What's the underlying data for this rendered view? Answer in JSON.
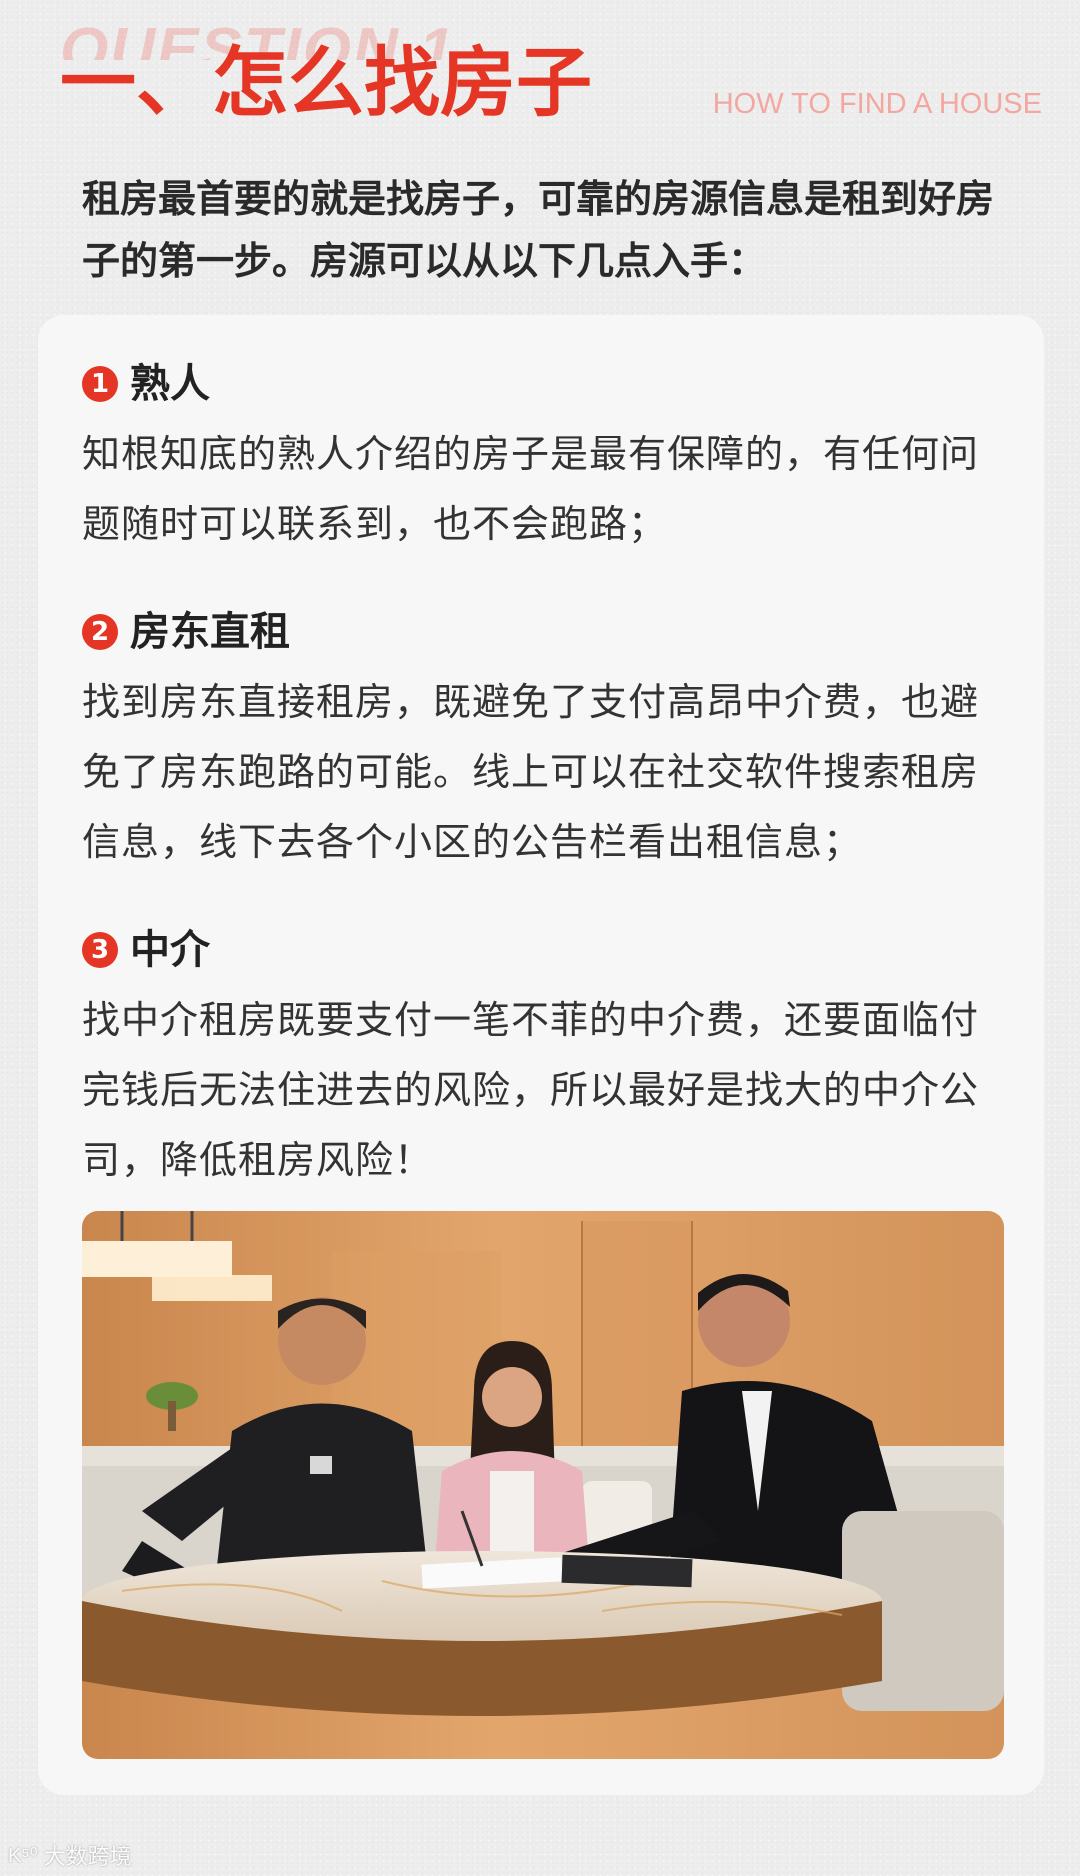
{
  "header": {
    "watermark": "QUESTION 1",
    "title": "一、怎么找房子",
    "subtitle_en": "HOW TO FIND A HOUSE"
  },
  "intro": "租房最首要的就是找房子，可靠的房源信息是租到好房子的第一步。房源可以从以下几点入手：",
  "sections": [
    {
      "number": "1",
      "title": "熟人",
      "body": "知根知底的熟人介绍的房子是最有保障的，有任何问题随时可以联系到，也不会跑路；"
    },
    {
      "number": "2",
      "title": "房东直租",
      "body": "找到房东直接租房，既避免了支付高昂中介费，也避免了房东跑路的可能。线上可以在社交软件搜索租房信息，线下去各个小区的公告栏看出租信息；"
    },
    {
      "number": "3",
      "title": "中介",
      "body": "找中介租房既要支付一笔不菲的中介费，还要面临付完钱后无法住进去的风险，所以最好是找大的中介公司，降低租房风险！"
    }
  ],
  "footer": {
    "logo_mark": "K⁵⁰",
    "logo_text": "大数跨境"
  },
  "colors": {
    "accent": "#e53524",
    "background": "#ededed",
    "card": "#f7f7f7"
  }
}
